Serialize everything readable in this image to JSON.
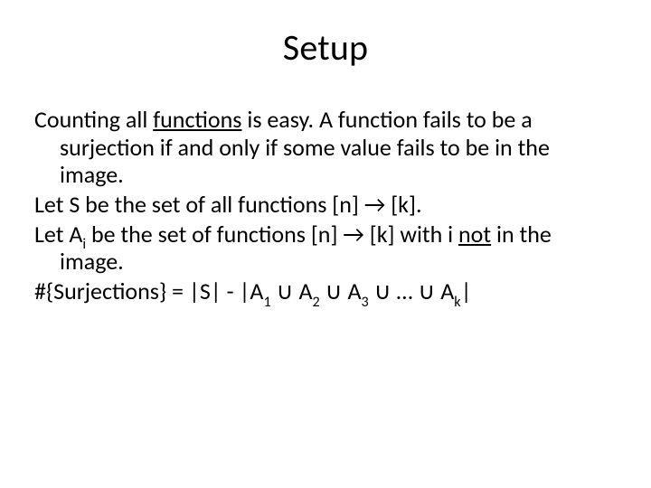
{
  "title": "Setup",
  "p1": {
    "a": "Counting all ",
    "b": "functions",
    "c": " is easy. A function fails to be a surjection if and only if some value fails to be in the image."
  },
  "p2": {
    "a": "Let S be the set of all functions [n] → [k]."
  },
  "p3": {
    "a": "Let A",
    "b": "i",
    "c": " be the set of functions [n] → [k] with i ",
    "d": "not",
    "e": " in the image."
  },
  "p4": {
    "a": "#{Surjections} = |S| - |A",
    "s1": "1",
    "u": " ∪ A",
    "s2": "2",
    "s3": "3",
    "el": " ∪ … ∪ A",
    "sk": "k",
    "end": "|"
  }
}
